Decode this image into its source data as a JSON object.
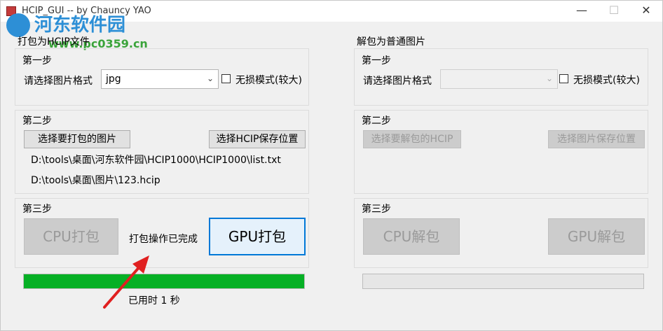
{
  "window": {
    "title": "HCIP_GUI -- by Chauncy YAO",
    "min": "—",
    "max": "☐",
    "close": "✕"
  },
  "watermark": {
    "name": "河东软件园",
    "url": "www.pc0359.cn"
  },
  "pack": {
    "title": "打包为HCIP文件",
    "step1": {
      "label": "第一步",
      "format_label": "请选择图片格式",
      "format_value": "jpg",
      "lossless_label": "无损模式(较大)"
    },
    "step2": {
      "label": "第二步",
      "select_btn": "选择要打包的图片",
      "save_btn": "选择HCIP保存位置",
      "source_path": "D:\\tools\\桌面\\河东软件园\\HCIP1000\\HCIP1000\\list.txt",
      "target_path": "D:\\tools\\桌面\\图片\\123.hcip"
    },
    "step3": {
      "label": "第三步",
      "cpu_btn": "CPU打包",
      "status": "打包操作已完成",
      "gpu_btn": "GPU打包"
    },
    "progress": 1.0,
    "elapsed": "已用时 1 秒"
  },
  "unpack": {
    "title": "解包为普通图片",
    "step1": {
      "label": "第一步",
      "format_label": "请选择图片格式",
      "format_value": "",
      "lossless_label": "无损模式(较大)"
    },
    "step2": {
      "label": "第二步",
      "select_btn": "选择要解包的HCIP",
      "save_btn": "选择图片保存位置"
    },
    "step3": {
      "label": "第三步",
      "cpu_btn": "CPU解包",
      "gpu_btn": "GPU解包"
    },
    "progress": 0
  },
  "colors": {
    "progress_fill": "#06b025",
    "accent": "#0078d7",
    "annotation_arrow": "#e02020"
  }
}
